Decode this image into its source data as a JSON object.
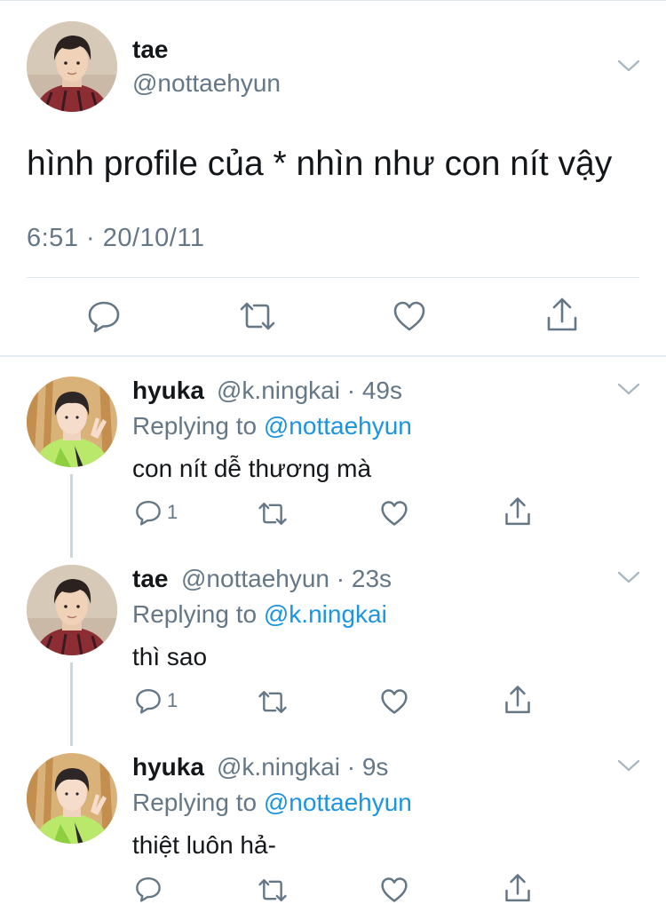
{
  "main_tweet": {
    "name": "tae",
    "handle": "@nottaehyun",
    "text": "hình profile của * nhìn như con nít vậy",
    "timestamp": "6:51 · 20/10/11",
    "avatar_icon": "avatar-tae",
    "actions": [
      "reply-icon",
      "retweet-icon",
      "like-icon",
      "share-icon"
    ]
  },
  "replies": [
    {
      "name": "hyuka",
      "meta": "@k.ningkai · 49s",
      "replying_prefix": "Replying to",
      "replying_to": "@nottaehyun",
      "text": "con nít dễ thương mà",
      "reply_count": "1",
      "avatar_icon": "avatar-hyuka"
    },
    {
      "name": "tae",
      "meta": "@nottaehyun · 23s",
      "replying_prefix": "Replying to",
      "replying_to": "@k.ningkai",
      "text": "thì sao",
      "reply_count": "1",
      "avatar_icon": "avatar-tae"
    },
    {
      "name": "hyuka",
      "meta": "@k.ningkai · 9s",
      "replying_prefix": "Replying to",
      "replying_to": "@nottaehyun",
      "text": "thiệt luôn hả-",
      "reply_count": "",
      "avatar_icon": "avatar-hyuka"
    }
  ],
  "colors": {
    "text": "#14171a",
    "secondary": "#657786",
    "mention": "#1b95e0",
    "divider": "#e1e8ed"
  }
}
